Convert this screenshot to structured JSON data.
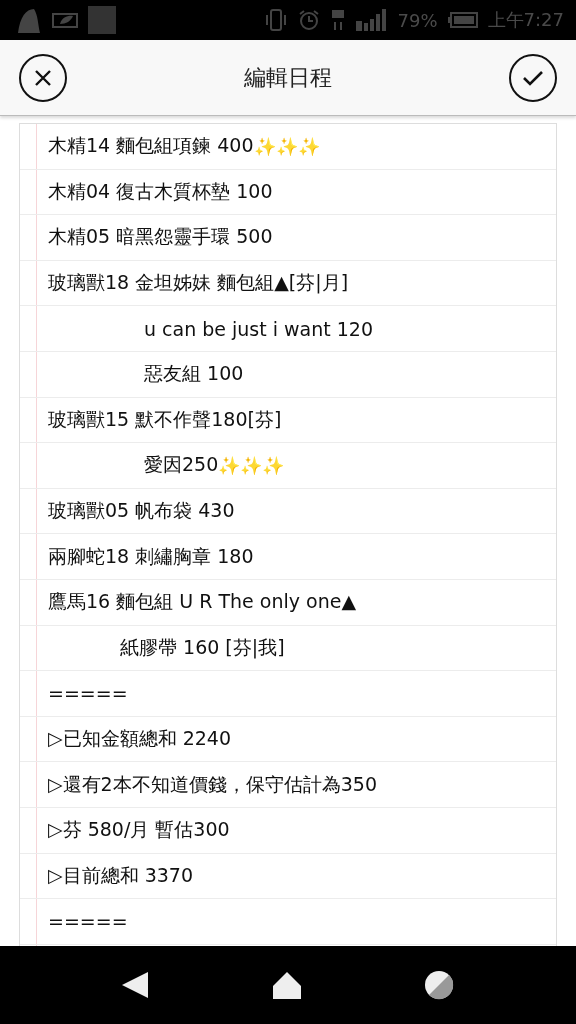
{
  "status_bar": {
    "battery_percent": "79%",
    "time": "上午7:27"
  },
  "header": {
    "title": "編輯日程"
  },
  "lines": [
    {
      "kind": "plain",
      "text": "木精14 麵包組項鍊 400",
      "sparkles": "✨✨✨"
    },
    {
      "kind": "plain",
      "text": "木精04 復古木質杯墊 100"
    },
    {
      "kind": "plain",
      "text": "木精05 暗黑怨靈手環 500"
    },
    {
      "kind": "plain",
      "text": "玻璃獸18 金坦姊妹 麵包組▲[芬|月]"
    },
    {
      "kind": "indented",
      "text": "u can be just i want 120"
    },
    {
      "kind": "indented",
      "text": "惡友組 100"
    },
    {
      "kind": "plain",
      "text": "玻璃獸15 默不作聲180[芬]"
    },
    {
      "kind": "indented",
      "text": "愛因250",
      "sparkles": "✨✨✨"
    },
    {
      "kind": "plain",
      "text": "玻璃獸05 帆布袋 430"
    },
    {
      "kind": "plain",
      "text": "兩腳蛇18 刺繡胸章 180"
    },
    {
      "kind": "plain",
      "text": "鷹馬16 麵包組 U R The only one▲"
    },
    {
      "kind": "half-indented",
      "text": "紙膠帶 160 [芬|我]"
    },
    {
      "kind": "plain",
      "text": "====="
    },
    {
      "kind": "plain",
      "text": "▷已知金額總和 2240"
    },
    {
      "kind": "plain",
      "text": "▷還有2本不知道價錢，保守估計為350"
    },
    {
      "kind": "plain",
      "text": "▷芬 580/月 暫估300"
    },
    {
      "kind": "plain",
      "text": "▷目前總和 3370"
    },
    {
      "kind": "plain",
      "text": "====="
    }
  ]
}
